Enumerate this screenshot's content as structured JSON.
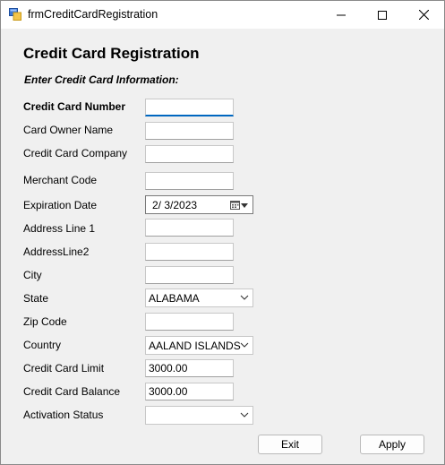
{
  "window": {
    "title": "frmCreditCardRegistration",
    "icon": "app-form-icon"
  },
  "titlebar_buttons": [
    "minimize-icon",
    "maximize-icon",
    "close-icon"
  ],
  "form": {
    "heading": "Credit Card Registration",
    "subheading": "Enter Credit Card Information:",
    "labels": {
      "card_number": "Credit Card Number",
      "owner_name": "Card Owner Name",
      "company": "Credit Card Company",
      "merchant_code": "Merchant Code",
      "expiration_date": "Expiration Date",
      "address1": "Address Line 1",
      "address2": "AddressLine2",
      "city": "City",
      "state": "State",
      "zip": "Zip Code",
      "country": "Country",
      "limit": "Credit Card Limit",
      "balance": "Credit Card Balance",
      "activation": "Activation Status"
    },
    "values": {
      "card_number": "",
      "owner_name": "",
      "company": "",
      "merchant_code": "",
      "expiration_date": "2/  3/2023",
      "address1": "",
      "address2": "",
      "city": "",
      "state": "ALABAMA",
      "zip": "",
      "country": "AALAND ISLANDS",
      "limit": "3000.00",
      "balance": "3000.00",
      "activation": ""
    }
  },
  "buttons": {
    "exit": "Exit",
    "apply": "Apply"
  },
  "colors": {
    "focus_accent": "#0067c0",
    "window_bg": "#f0f0f0"
  }
}
